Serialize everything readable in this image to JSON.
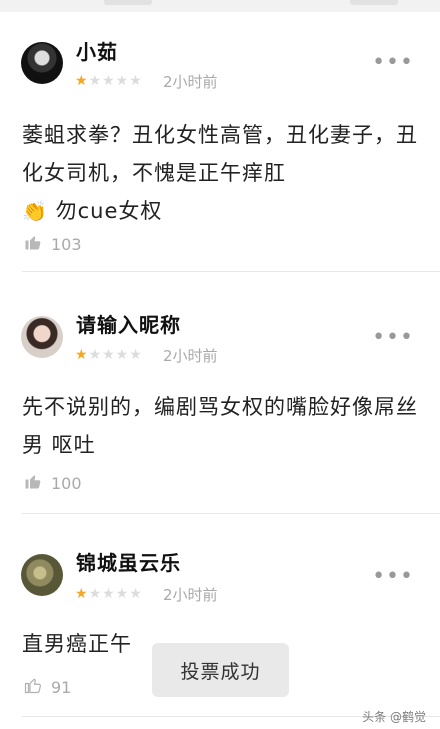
{
  "comments": [
    {
      "username": "小茹",
      "rating": 1,
      "time": "2小时前",
      "text_before_emoji": "萎蛆求拳？丑化女性高管，丑化妻子，丑化女司机，不愧是正午痒肛",
      "emoji": "👏",
      "text_after_emoji": "勿cue女权",
      "likes": "103"
    },
    {
      "username": "请输入昵称",
      "rating": 1,
      "time": "2小时前",
      "text": "先不说别的，编剧骂女权的嘴脸好像屌丝男 呕吐",
      "likes": "100"
    },
    {
      "username": "锦城虽云乐",
      "rating": 1,
      "time": "2小时前",
      "text": "直男癌正午",
      "likes": "91"
    }
  ],
  "toast": "投票成功",
  "watermark": "头条 @鹤觉"
}
